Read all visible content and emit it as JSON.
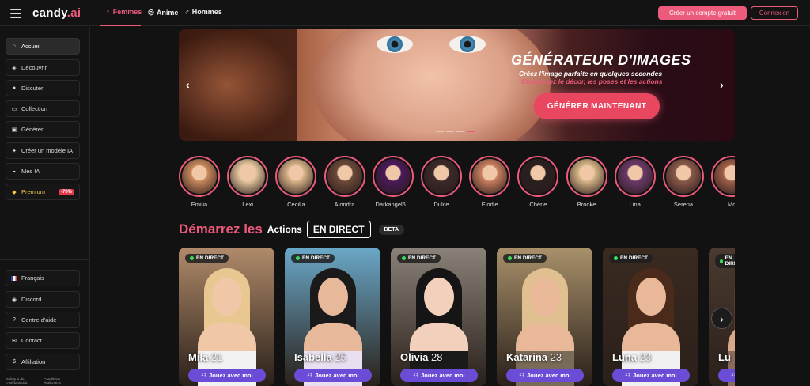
{
  "header": {
    "logo_text": "candy",
    "logo_suffix": ".ai",
    "tabs": [
      {
        "label": "Femmes",
        "icon": "female-icon"
      },
      {
        "label": "Anime",
        "icon": "anime-icon"
      },
      {
        "label": "Hommes",
        "icon": "male-icon"
      }
    ],
    "signup_label": "Créer un compte gratuit",
    "login_label": "Connexion"
  },
  "sidebar": {
    "items": [
      {
        "label": "Accueil",
        "icon": "home-icon"
      },
      {
        "label": "Découvrir",
        "icon": "compass-icon"
      },
      {
        "label": "Discuter",
        "icon": "chat-icon"
      },
      {
        "label": "Collection",
        "icon": "collection-icon"
      },
      {
        "label": "Générer",
        "icon": "image-icon"
      },
      {
        "label": "Créer un modèle IA",
        "icon": "magic-icon"
      },
      {
        "label": "Mes IA",
        "icon": "mask-icon"
      },
      {
        "label": "Premium",
        "icon": "diamond-icon",
        "badge": "-70%"
      }
    ],
    "bottom_items": [
      {
        "label": "Français",
        "icon": "flag-fr-icon"
      },
      {
        "label": "Discord",
        "icon": "discord-icon"
      },
      {
        "label": "Centre d'aide",
        "icon": "help-icon"
      },
      {
        "label": "Contact",
        "icon": "mail-icon"
      },
      {
        "label": "Affiliation",
        "icon": "dollar-icon"
      }
    ],
    "footer": {
      "privacy": "Politique de confidentialité",
      "terms": "Conditions d'utilisation"
    }
  },
  "banner": {
    "title": "GÉNÉRATEUR D'IMAGES",
    "subtitle1": "Créez l'image parfaite en quelques secondes",
    "subtitle2": "Choisissez le décor, les poses et les actions",
    "cta": "GÉNÉRER MAINTENANT",
    "prev_arrow": "‹",
    "next_arrow": "›",
    "active_slide": 4,
    "slide_count": 4
  },
  "stories": [
    {
      "name": "Emilia",
      "color": "#c98a5c"
    },
    {
      "name": "Lexi",
      "color": "#e8c9a0"
    },
    {
      "name": "Cecilia",
      "color": "#d9b48a"
    },
    {
      "name": "Alondra",
      "color": "#6b4a3a"
    },
    {
      "name": "Darkangel6...",
      "color": "#4a1a5a"
    },
    {
      "name": "Dulce",
      "color": "#3a2a2a"
    },
    {
      "name": "Elodie",
      "color": "#c98060"
    },
    {
      "name": "Chérie",
      "color": "#2a2020"
    },
    {
      "name": "Brooke",
      "color": "#d8b888"
    },
    {
      "name": "Lina",
      "color": "#6a3a6a"
    },
    {
      "name": "Serena",
      "color": "#8a5a4a"
    },
    {
      "name": "Mo",
      "color": "#a06048"
    }
  ],
  "live_section": {
    "title_pink": "Démarrez les",
    "title_white": "Actions",
    "live_badge": "EN DIRECT",
    "beta": "BETA"
  },
  "cards": [
    {
      "name": "Mila",
      "age": "21",
      "live": "EN DIRECT",
      "play": "Jouez avec moi",
      "bg": "#b08a6a",
      "hair": "#e8c890",
      "skin": "#f0c8a8",
      "top": "#f2f2f2"
    },
    {
      "name": "Isabella",
      "age": "25",
      "live": "EN DIRECT",
      "play": "Jouez avec moi",
      "bg": "#6aa8c8",
      "hair": "#1a1a1a",
      "skin": "#e8b89a",
      "top": "#e8e0f0"
    },
    {
      "name": "Olivia",
      "age": "28",
      "live": "EN DIRECT",
      "play": "Jouez avec moi",
      "bg": "#8a8278",
      "hair": "#151515",
      "skin": "#f2d0bc",
      "top": "#1a1a1a"
    },
    {
      "name": "Katarina",
      "age": "23",
      "live": "EN DIRECT",
      "play": "Jouez avec moi",
      "bg": "#a8906a",
      "hair": "#e0c090",
      "skin": "#e8b898",
      "top": "#7a6a58"
    },
    {
      "name": "Luna",
      "age": "23",
      "live": "EN DIRECT",
      "play": "Jouez avec moi",
      "bg": "#3a2a20",
      "hair": "#4a2a1a",
      "skin": "#e8b898",
      "top": "#f0f0f0"
    },
    {
      "name": "Lu",
      "age": "",
      "live": "EN DIRECT",
      "play": "Jouez avec moi",
      "bg": "#4a3a30",
      "hair": "#5a3a2a",
      "skin": "#d8a888",
      "top": "#8a6a5a"
    }
  ]
}
